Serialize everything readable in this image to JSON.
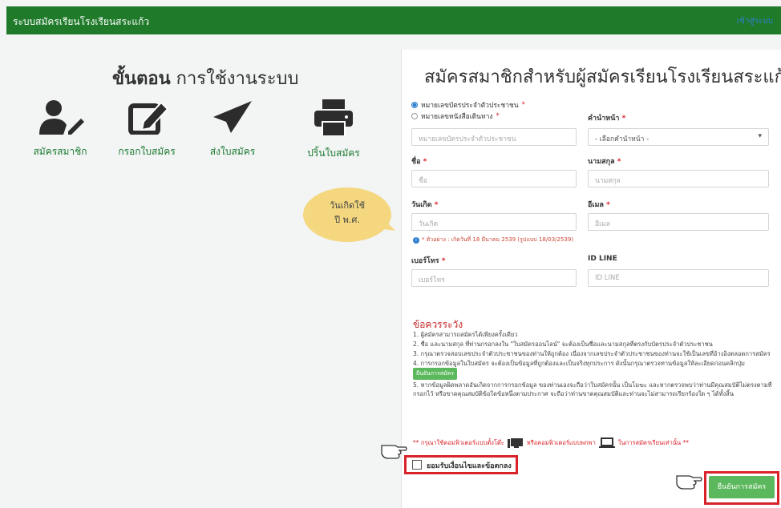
{
  "navbar": {
    "title": "ระบบสมัครเรียนโรงเรียนสระแก้ว",
    "link": "เข้าสู่ระบบ"
  },
  "steps": {
    "title_bold": "ขั้นตอน",
    "title_rest": " การใช้งานระบบ",
    "items": [
      {
        "label": "สมัครสมาชิก",
        "icon": "user-edit-icon"
      },
      {
        "label": "กรอกใบสมัคร",
        "icon": "edit-icon"
      },
      {
        "label": "ส่งใบสมัคร",
        "icon": "paper-plane-icon"
      },
      {
        "label": "ปริ้นใบสมัคร",
        "icon": "printer-icon"
      }
    ]
  },
  "bubble": {
    "line1": "วันเกิดใช้",
    "line2": "ปี พ.ศ."
  },
  "form": {
    "title": "สมัครสมาชิกสำหรับผู้สมัครเรียนโรงเรียนสระแก้ว",
    "radio_id": "หมายเลขบัตรประจำตัวประชาชน",
    "radio_passport": "หมายเลขหนังสือเดินทาง",
    "required_mark": "*",
    "id_placeholder": "หมายเลขบัตรประจำตัวประชาชน",
    "prefix_label": "คำนำหน้า",
    "prefix_value": "- เลือกคำนำหน้า -",
    "firstname_label": "ชื่อ",
    "firstname_placeholder": "ชื่อ",
    "lastname_label": "นามสกุล",
    "lastname_placeholder": "นามสกุล",
    "birthdate_label": "วันเกิด",
    "birthdate_placeholder": "วันเกิด",
    "email_label": "อีเมล",
    "email_placeholder": "อีเมล",
    "birthdate_hint": "* ตัวอย่าง : เกิดวันที่ 18 มีนาคม 2539 (รูปแบบ 18/03/2539)",
    "phone_label": "เบอร์โทร",
    "phone_placeholder": "เบอร์โทร",
    "line_label": "ID LINE",
    "line_placeholder": "ID LINE"
  },
  "terms": {
    "title": "ข้อควรระวัง",
    "item1": "1. ผู้สมัครสามารถสมัครได้เพียงครั้งเดียว",
    "item2": "2. ชื่อ และนามสกุล ที่ท่านกรอกลงใน \"ใบสมัครออนไลน์\" จะต้องเป็นชื่อและนามสกุลที่ตรงกับบัตรประจำตัวประชาชน",
    "item3": "3. กรุณาตรวจสอบเลขประจำตัวประชาชนของท่านให้ถูกต้อง เนื่องจากเลขประจำตัวประชาชนของท่านจะใช้เป็นเลขที่อ้างอิงตลอดการสมัคร",
    "item4_a": "4. การกรอกข้อมูลในใบสมัคร จะต้องเป็นข้อมูลที่ถูกต้องและเป็นจริงทุกประการ ดังนั้นกรุณาตรวจทานข้อมูลให้ละเอียดก่อนคลิกปุ่ม",
    "item4_btn": "ยืนยันการสมัคร",
    "item5": "5. หากข้อมูลผิดพลาดอันเกิดจากการกรอกข้อมูล ของท่านเองจะถือว่าใบสมัครนั้น เป็นโมฆะ และหากตรวจพบว่าท่านมีคุณสมบัติไม่ตรงตามที่กรอกไว้ หรือขาดคุณสมบัติข้อใดข้อหนึ่งตามประกาศ จะถือว่าท่านขาดคุณสมบัติและท่านจะไม่สามารถเรียกร้องใด ๆ ได้ทั้งสิ้น"
  },
  "note": {
    "part1": "** กรุณาใช้คอมพิวเตอร์แบบตั้งโต๊ะ",
    "part2": "หรือคอมพิวเตอร์แบบพกพา",
    "part3": "ในการสมัครเรียนเท่านั้น **"
  },
  "agree_label": "ยอมรับเงื่อนไขและข้อตกลง",
  "submit_label": "ยืนยันการสมัคร",
  "colors": {
    "navbar": "#1f7a2a",
    "accent": "#5cb85c",
    "warning": "#d8232a",
    "bubble": "#f4d77f"
  }
}
